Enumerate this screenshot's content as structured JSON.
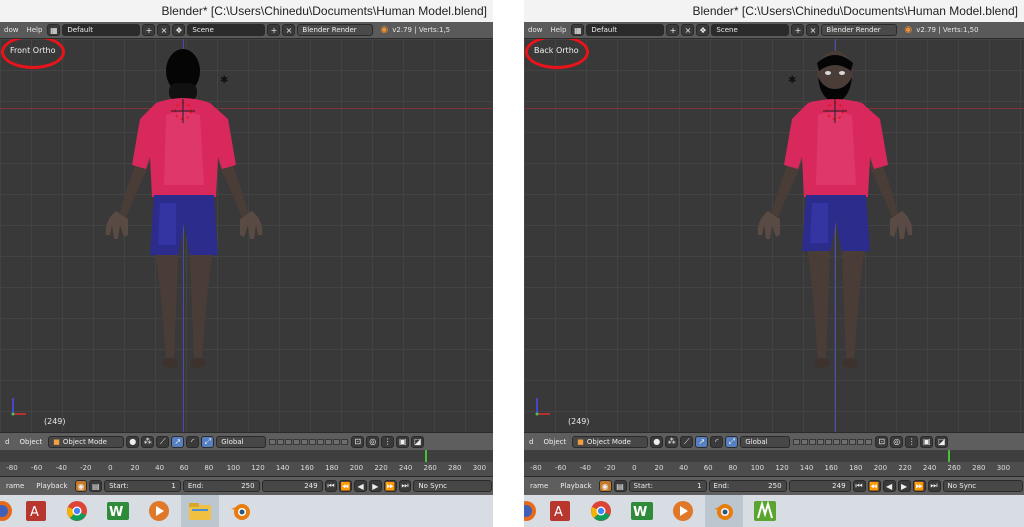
{
  "left": {
    "window_title": "Blender* [C:\\Users\\Chinedu\\Documents\\Human Model.blend]",
    "menu_window": "dow",
    "menu_help": "Help",
    "screen_layout": "Default",
    "scene": "Scene",
    "render_engine": "Blender Render",
    "version_stats": "v2.79 | Verts:1,5",
    "view_label": "Front Ortho",
    "frame_indicator": "(249)",
    "header_menu_select": "d",
    "header_menu_object": "Object",
    "object_mode": "Object Mode",
    "orientation": "Global",
    "timeline_menu_frame": "rame",
    "timeline_menu_playback": "Playback",
    "start_label": "Start:",
    "start_value": "1",
    "end_label": "End:",
    "end_value": "250",
    "current_frame": "249",
    "sync_mode": "No Sync",
    "ruler_labels": [
      "-80",
      "-60",
      "-40",
      "-20",
      "0",
      "20",
      "40",
      "60",
      "80",
      "100",
      "120",
      "140",
      "160",
      "180",
      "200",
      "220",
      "240",
      "260",
      "280",
      "300"
    ]
  },
  "right": {
    "window_title": "Blender* [C:\\Users\\Chinedu\\Documents\\Human Model.blend]",
    "menu_window": "dow",
    "menu_help": "Help",
    "screen_layout": "Default",
    "scene": "Scene",
    "render_engine": "Blender Render",
    "version_stats": "v2.79 | Verts:1,50",
    "view_label": "Back Ortho",
    "frame_indicator": "(249)",
    "header_menu_select": "d",
    "header_menu_object": "Object",
    "object_mode": "Object Mode",
    "orientation": "Global",
    "timeline_menu_frame": "rame",
    "timeline_menu_playback": "Playback",
    "start_label": "Start:",
    "start_value": "1",
    "end_label": "End:",
    "end_value": "250",
    "current_frame": "249",
    "sync_mode": "No Sync",
    "ruler_labels": [
      "-80",
      "-60",
      "-40",
      "-20",
      "0",
      "20",
      "40",
      "60",
      "80",
      "100",
      "120",
      "140",
      "160",
      "180",
      "200",
      "220",
      "240",
      "260",
      "280",
      "300"
    ]
  },
  "colors": {
    "highlight_circle": "#e8141a",
    "shirt": "#d8285c",
    "shorts": "#2c2c8c",
    "skin": "#4a3d38",
    "viewport_bg": "#393939",
    "playhead": "#49c03b"
  },
  "taskbar_icons_left": [
    "firefox-icon",
    "access-icon",
    "chrome-icon",
    "word-tool-icon",
    "media-player-icon",
    "file-explorer-icon",
    "blender-icon"
  ],
  "taskbar_icons_right": [
    "firefox-icon",
    "access-icon",
    "chrome-icon",
    "word-tool-icon",
    "media-player-icon",
    "blender-icon",
    "green-app-icon"
  ]
}
